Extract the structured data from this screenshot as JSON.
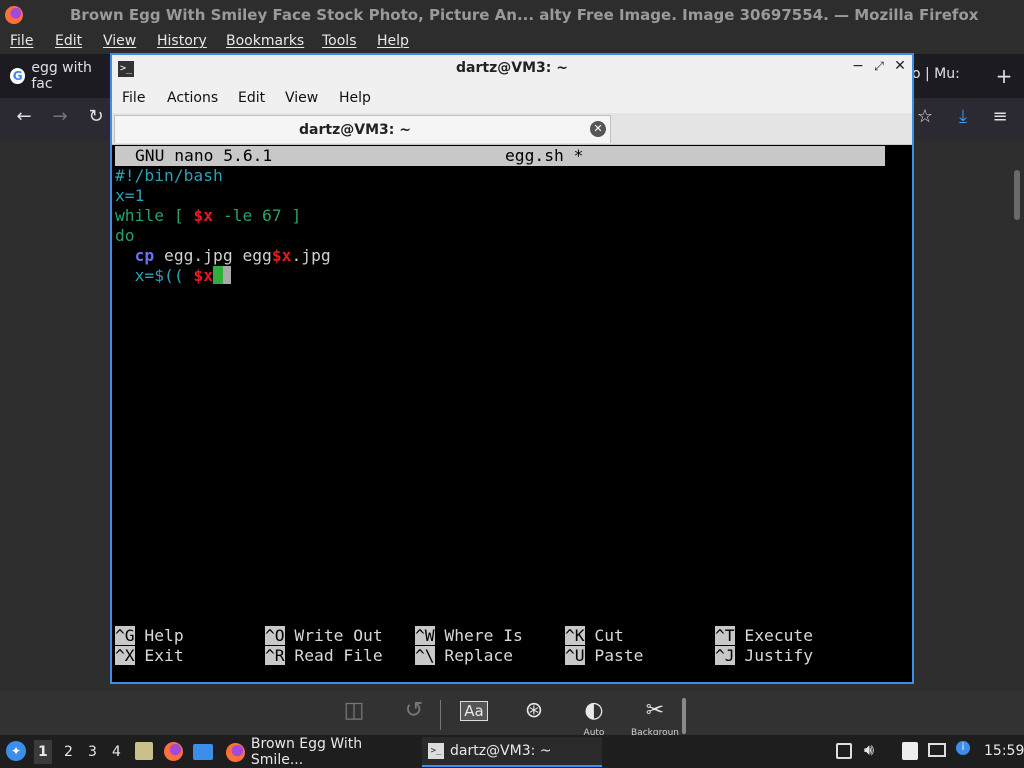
{
  "firefox": {
    "title": "Brown Egg With Smiley Face Stock Photo, Picture An... alty Free Image. Image 30697554. — Mozilla Firefox",
    "menu": [
      "File",
      "Edit",
      "View",
      "History",
      "Bookmarks",
      "Tools",
      "Help"
    ],
    "tab1_label": "egg with fac",
    "tab2_label": "o | Mu:",
    "bottom_labels": {
      "auto": "Auto",
      "background": "Backgroun"
    }
  },
  "terminal": {
    "title": "dartz@VM3: ~",
    "menu": [
      "File",
      "Actions",
      "Edit",
      "View",
      "Help"
    ],
    "tab_label": "dartz@VM3: ~",
    "nano": {
      "version": "GNU nano 5.6.1",
      "filename": "egg.sh *",
      "lines": {
        "l1": "#!/bin/bash",
        "l2": "x=1",
        "l3_a": "while [ ",
        "l3_b": "$x",
        "l3_c": " -le 67 ]",
        "l4": "do",
        "l5_a": "  ",
        "l5_b": "cp",
        "l5_c": " egg.jpg egg",
        "l5_d": "$x",
        "l5_e": ".jpg",
        "l6_a": "  x=$(( ",
        "l6_b": "$x"
      },
      "shortcuts": [
        {
          "key": "^G",
          "label": " Help"
        },
        {
          "key": "^X",
          "label": " Exit"
        },
        {
          "key": "^O",
          "label": " Write Out"
        },
        {
          "key": "^R",
          "label": " Read File"
        },
        {
          "key": "^W",
          "label": " Where Is"
        },
        {
          "key": "^\\",
          "label": " Replace"
        },
        {
          "key": "^K",
          "label": " Cut"
        },
        {
          "key": "^U",
          "label": " Paste"
        },
        {
          "key": "^T",
          "label": " Execute"
        },
        {
          "key": "^J",
          "label": " Justify"
        }
      ]
    }
  },
  "taskbar": {
    "workspaces": [
      "1",
      "2",
      "3",
      "4"
    ],
    "win1": "Brown Egg With Smile...",
    "win2": "dartz@VM3: ~",
    "clock": "15:59"
  }
}
